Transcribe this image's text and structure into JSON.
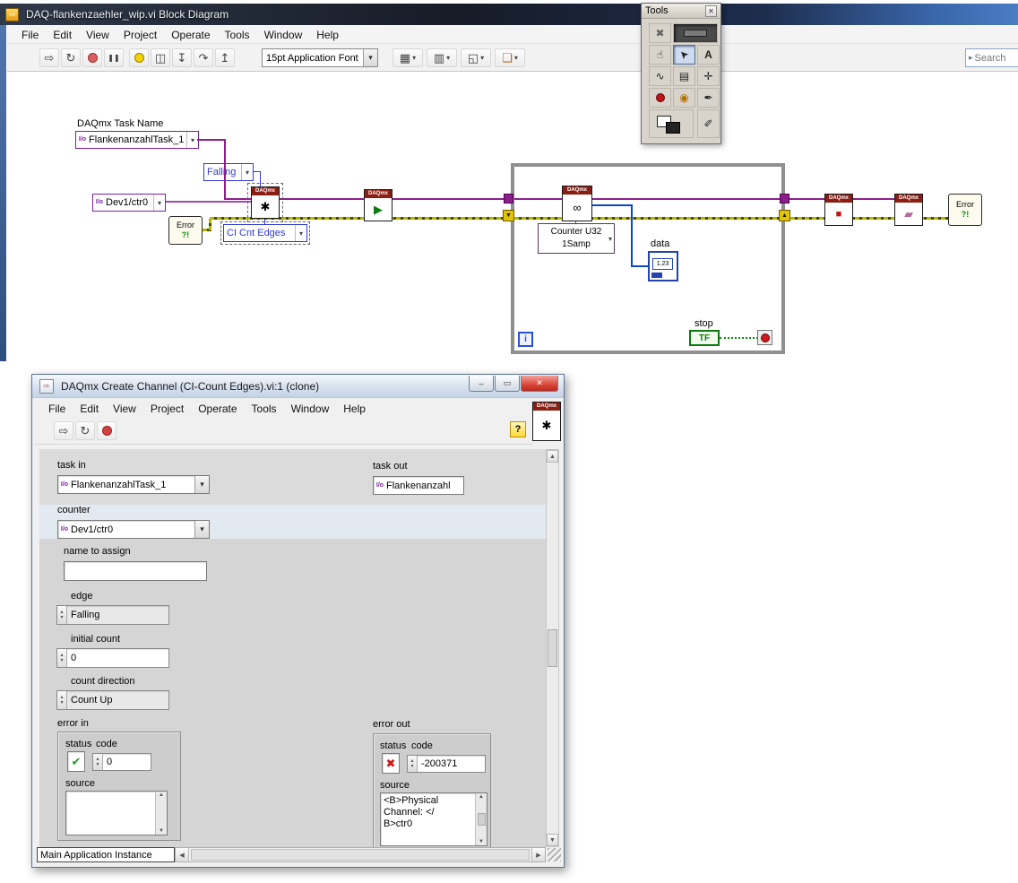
{
  "icons": {
    "run": "⇨",
    "run_continuous": "↻",
    "pause": "❚❚",
    "step_into": "↧",
    "step_over": "↷",
    "step_out": "↥",
    "retain": "◫",
    "align": "▦",
    "distribute": "▥",
    "resize": "◱",
    "reorder": "❏",
    "dropdown": "▾",
    "search_arrow": "▸",
    "close": "✕",
    "minimize": "–",
    "restore": "▭",
    "up": "▲",
    "down": "▼",
    "left": "◀",
    "right": "▶",
    "spin_up": "▴",
    "spin_down": "▾",
    "check": "✔",
    "cross": "✖",
    "help": "?",
    "tool_auto": "✖",
    "tool_operate": "☝",
    "tool_position": "➤",
    "tool_label": "A",
    "tool_wire": "∿",
    "tool_menu": "▤",
    "tool_scroll": "✛",
    "tool_probe": "◉",
    "tool_copycolor": "✒",
    "tool_brush": "✐",
    "io_glyph": "I/o",
    "node_create": "✱",
    "node_start": "▶",
    "node_read": "∞",
    "node_stop": "■",
    "node_clear": "▰",
    "error_mark": "?!"
  },
  "block_diagram_window": {
    "title": "DAQ-flankenzaehler_wip.vi Block Diagram",
    "menu": [
      "File",
      "Edit",
      "View",
      "Project",
      "Operate",
      "Tools",
      "Window",
      "Help"
    ],
    "font_selector": "15pt Application Font",
    "search": "Search"
  },
  "tools_palette": {
    "title": "Tools"
  },
  "diagram": {
    "task_name_label": "DAQmx Task Name",
    "task_name": "FlankenanzahlTask_1",
    "edge": "Falling",
    "counter": "Dev1/ctr0",
    "cnt_edges": "CI Cnt Edges",
    "daqmx": "DAQmx",
    "read_mode_line1": "Counter U32",
    "read_mode_line2": "1Samp",
    "data_label": "data",
    "data_value": "1.23",
    "stop_label": "stop",
    "tf": "TF",
    "iteration": "i",
    "error_text": "Error"
  },
  "front_panel_window": {
    "title": "DAQmx Create Channel (CI-Count Edges).vi:1 (clone)",
    "menu": [
      "File",
      "Edit",
      "View",
      "Project",
      "Operate",
      "Tools",
      "Window",
      "Help"
    ],
    "daqmx": "DAQmx",
    "task_in_label": "task in",
    "task_in": "FlankenanzahlTask_1",
    "task_out_label": "task out",
    "task_out": "Flankenanzahl",
    "counter_label": "counter",
    "counter": "Dev1/ctr0",
    "name_label": "name to assign",
    "edge_label": "edge",
    "edge": "Falling",
    "initial_count_label": "initial count",
    "initial_count": "0",
    "count_direction_label": "count direction",
    "count_direction": "Count Up",
    "error_in_label": "error in",
    "error_out_label": "error out",
    "status_label": "status",
    "code_label": "code",
    "source_label": "source",
    "error_in_code": "0",
    "error_out_code": "-200371",
    "source_line1": "<B>Physical",
    "source_line2": "Channel: </",
    "source_line3": "B>ctr0",
    "status_bar": "Main Application Instance"
  }
}
